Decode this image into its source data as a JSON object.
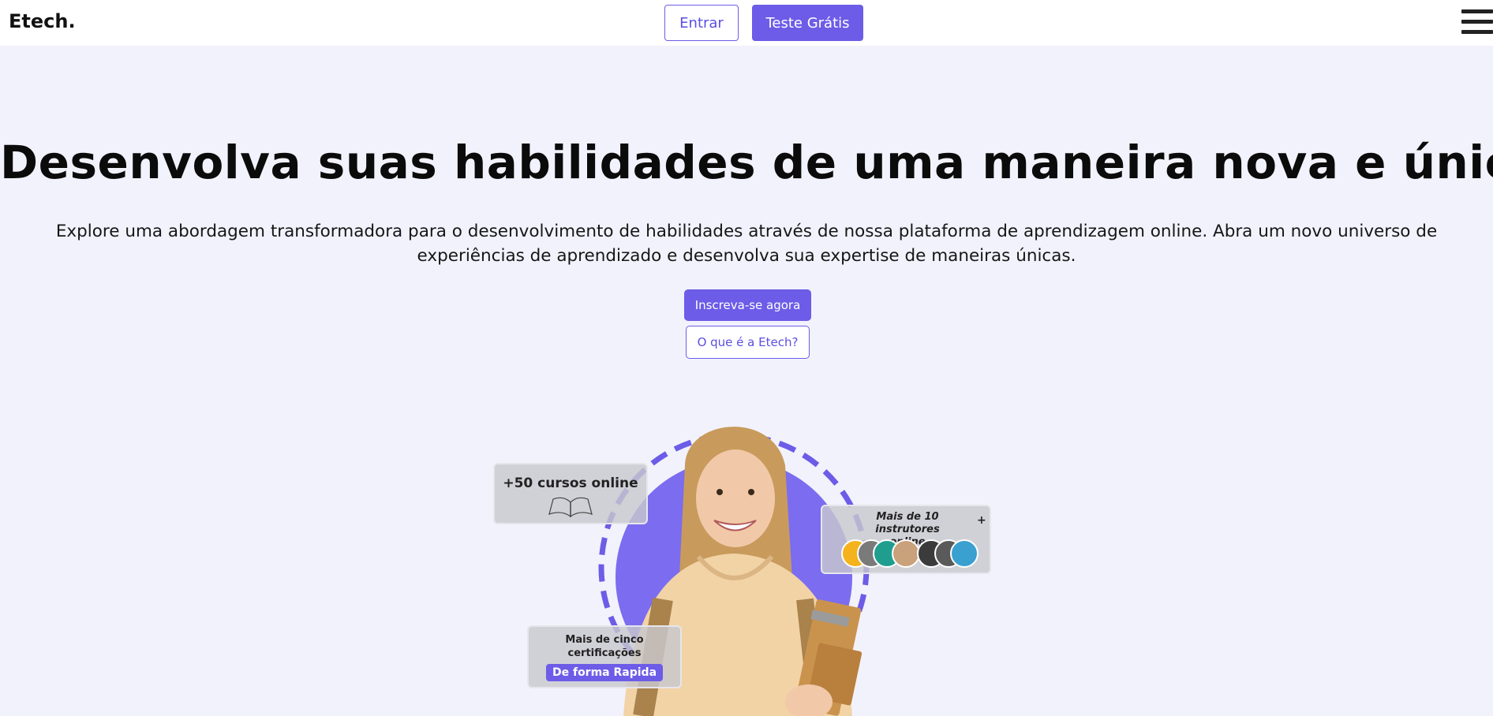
{
  "header": {
    "logo": "Etech.",
    "login_label": "Entrar",
    "trial_label": "Teste Grátis"
  },
  "hero": {
    "title": "Desenvolva suas habilidades de uma maneira nova e única",
    "subtitle": "Explore uma abordagem transformadora para o desenvolvimento de habilidades através de nossa plataforma de aprendizagem online. Abra um novo universo de experiências de aprendizado e desenvolva sua expertise de maneiras únicas.",
    "signup_label": "Inscreva-se agora",
    "what_label": "O que é a Etech?"
  },
  "cards": {
    "courses": "+50 cursos online",
    "instructors": "Mais de 10 instrutores online",
    "instructors_more": "+",
    "certs": "Mais de cinco certificações",
    "certs_pill": "De forma Rapida"
  },
  "colors": {
    "accent": "#6c5ce7",
    "background": "#f2f2fc",
    "avatar_colors": [
      "#f4b31c",
      "#7a7a7a",
      "#1f9e8f",
      "#c9a17a",
      "#3b3b3b",
      "#5a5a5a",
      "#3aa0d0"
    ]
  }
}
